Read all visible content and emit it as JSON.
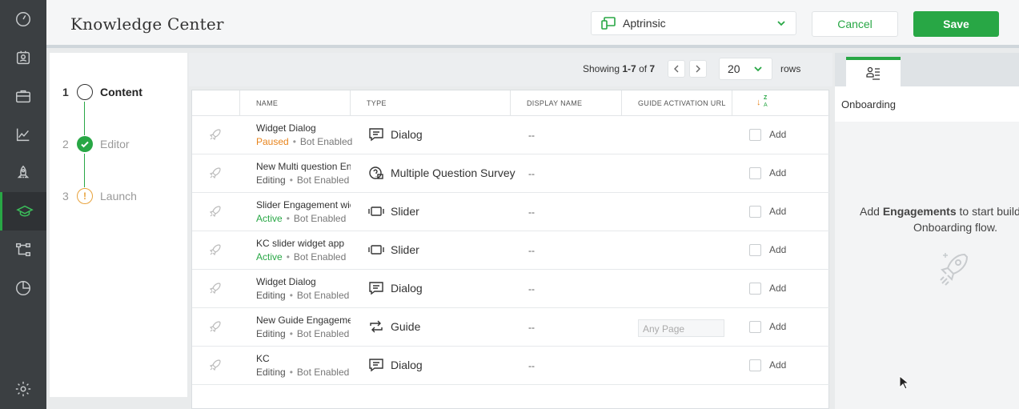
{
  "header": {
    "title": "Knowledge Center",
    "app_selected": "Aptrinsic",
    "cancel_label": "Cancel",
    "save_label": "Save"
  },
  "nav": {
    "items": [
      "dashboard-icon",
      "contacts-icon",
      "briefcase-icon",
      "analytics-icon",
      "rocket-icon",
      "knowledge-center-icon",
      "journey-icon",
      "reports-icon",
      "settings-icon"
    ],
    "active": "knowledge-center-icon"
  },
  "steps": [
    {
      "num": "1",
      "label": "Content",
      "state": "current"
    },
    {
      "num": "2",
      "label": "Editor",
      "state": "done"
    },
    {
      "num": "3",
      "label": "Launch",
      "state": "warning"
    }
  ],
  "pagination": {
    "showing_prefix": "Showing",
    "range": "1-7",
    "of_word": "of",
    "total": "7",
    "rows_value": "20",
    "rows_label": "rows"
  },
  "table": {
    "columns": [
      "NAME",
      "TYPE",
      "DISPLAY NAME",
      "GUIDE ACTIVATION URL"
    ],
    "sort_label_top": "Z",
    "sort_label_bottom": "A",
    "add_label": "Add",
    "rows": [
      {
        "name": "Widget Dialog",
        "status": "Paused",
        "status_kind": "paused",
        "bot": "Bot Enabled",
        "type": "Dialog",
        "type_icon": "dialog-icon",
        "display": "--",
        "url": ""
      },
      {
        "name": "New Multi question En",
        "status": "Editing",
        "status_kind": "editing",
        "bot": "Bot Enabled",
        "type": "Multiple Question Survey",
        "type_icon": "survey-icon",
        "display": "--",
        "url": ""
      },
      {
        "name": "Slider Engagement wic",
        "status": "Active",
        "status_kind": "active",
        "bot": "Bot Enabled",
        "type": "Slider",
        "type_icon": "slider-icon",
        "display": "--",
        "url": ""
      },
      {
        "name": "KC slider widget app",
        "status": "Active",
        "status_kind": "active",
        "bot": "Bot Enabled",
        "type": "Slider",
        "type_icon": "slider-icon",
        "display": "--",
        "url": ""
      },
      {
        "name": "Widget Dialog",
        "status": "Editing",
        "status_kind": "editing",
        "bot": "Bot Enabled",
        "type": "Dialog",
        "type_icon": "dialog-icon",
        "display": "--",
        "url": ""
      },
      {
        "name": "New Guide Engageme",
        "status": "Editing",
        "status_kind": "editing",
        "bot": "Bot Enabled",
        "type": "Guide",
        "type_icon": "guide-icon",
        "display": "--",
        "url_placeholder": "Any Page"
      },
      {
        "name": "KC",
        "status": "Editing",
        "status_kind": "editing",
        "bot": "Bot Enabled",
        "type": "Dialog",
        "type_icon": "dialog-icon",
        "display": "--",
        "url": ""
      }
    ]
  },
  "right_panel": {
    "section_title": "Onboarding",
    "empty_prefix": "Add",
    "empty_bold": "Engagements",
    "empty_suffix": "to start buildi",
    "empty_line2": "Onboarding flow."
  },
  "colors": {
    "brand_green": "#28a745",
    "paused_orange": "#e8841c",
    "nav_bg": "#3b3f42"
  }
}
